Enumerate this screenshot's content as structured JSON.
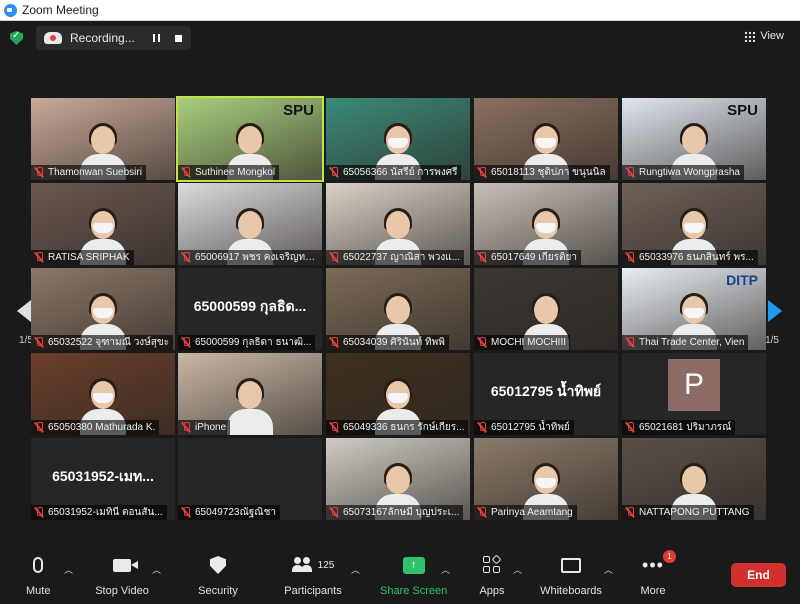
{
  "window": {
    "title": "Zoom Meeting"
  },
  "recording": {
    "label": "Recording..."
  },
  "view": {
    "label": "View"
  },
  "pagination": {
    "left": "1/5",
    "right": "1/5"
  },
  "tiles": [
    {
      "name": "Thamonwan Suebsiri",
      "kind": "video",
      "bg": "#c9a998"
    },
    {
      "name": "Suthinee Mongkol",
      "kind": "video",
      "bg": "#a9cf7e",
      "logo": "SPU",
      "active": true
    },
    {
      "name": "65056366 นัสรีย์ การพงศรี",
      "kind": "video",
      "bg": "#3a8a78"
    },
    {
      "name": "65018113 ชุติปภา ขนุนนิล",
      "kind": "video",
      "bg": "#8a7060"
    },
    {
      "name": "Rungtiwa Wongprasha",
      "kind": "video",
      "bg": "#dfe7ef",
      "logo": "SPU"
    },
    {
      "name": "RATISA SRIPHAK",
      "kind": "video",
      "bg": "#6b5850"
    },
    {
      "name": "65006917 พชร คงเจริญทร...",
      "kind": "video",
      "bg": "#dcdcdc"
    },
    {
      "name": "65022737 ญาณิสา พวงแ...",
      "kind": "video",
      "bg": "#d9d2c8"
    },
    {
      "name": "65017649 เกียรติยา",
      "kind": "video",
      "bg": "#c8c0b8"
    },
    {
      "name": "65033976 ธนภสินทร์ พร...",
      "kind": "video",
      "bg": "#6e6158"
    },
    {
      "name": "65032522 จุฑามณี วงษ์สุขะ",
      "kind": "video",
      "bg": "#8a7768"
    },
    {
      "name": "65000599 กุลธิดา ธนาฒิ...",
      "kind": "text",
      "big": "65000599 กุลธิด..."
    },
    {
      "name": "65034039 ศิรินันท์ ทิพพิ",
      "kind": "video",
      "bg": "#7a6a58"
    },
    {
      "name": "MOCHI MOCHIII",
      "kind": "video",
      "bg": "#3a3632"
    },
    {
      "name": "Thai Trade Center, Vien",
      "kind": "video",
      "bg": "#e9eef4",
      "logo": "DITP"
    },
    {
      "name": "65050380 Mathurada K.",
      "kind": "video",
      "bg": "#6a3f2a"
    },
    {
      "name": "iPhone",
      "kind": "video",
      "bg": "#c9b8a8"
    },
    {
      "name": "65049336 ธนกร รักษ์เกียร...",
      "kind": "video",
      "bg": "#3e3020"
    },
    {
      "name": "65012795 น้ำทิพย์",
      "kind": "text",
      "big": "65012795 น้ำทิพย์"
    },
    {
      "name": "65021681 ปริมาภรณ์",
      "kind": "avatar",
      "letter": "P"
    },
    {
      "name": "65031952-เมทินี ตอนสัน...",
      "kind": "text",
      "big": "65031952-เมท..."
    },
    {
      "name": "65049723ณัฐณิชา",
      "kind": "blank"
    },
    {
      "name": "65073167ลักษมี บุญประเ...",
      "kind": "video",
      "bg": "#d0ccc4"
    },
    {
      "name": "Parinya Aeamtang",
      "kind": "video",
      "bg": "#8a7a6a"
    },
    {
      "name": "NATTAPONG PUTTANG",
      "kind": "video",
      "bg": "#5a5048"
    }
  ],
  "toolbar": {
    "mute": "Mute",
    "stop_video": "Stop Video",
    "security": "Security",
    "participants": "Participants",
    "participants_count": "125",
    "share_screen": "Share Screen",
    "apps": "Apps",
    "whiteboards": "Whiteboards",
    "more": "More",
    "more_badge": "1",
    "end": "End"
  },
  "colors": {
    "accent_green": "#2dc26b",
    "active_border": "#c4e04a",
    "end_red": "#d32f2f",
    "nav_blue": "#1d9bf0"
  }
}
